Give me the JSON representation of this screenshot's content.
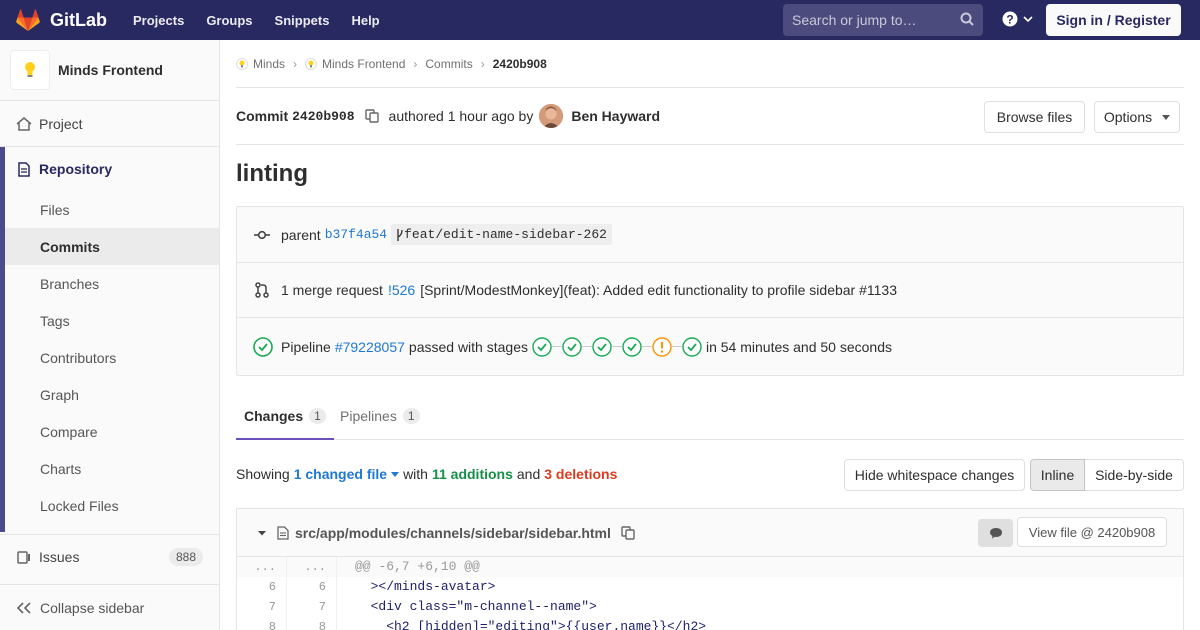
{
  "navbar": {
    "brand": "GitLab",
    "links": [
      "Projects",
      "Groups",
      "Snippets",
      "Help"
    ],
    "search_placeholder": "Search or jump to…",
    "signin_label": "Sign in / Register"
  },
  "sidebar": {
    "project_name": "Minds Frontend",
    "project_item": "Project",
    "repository": "Repository",
    "repo_items": [
      "Files",
      "Commits",
      "Branches",
      "Tags",
      "Contributors",
      "Graph",
      "Compare",
      "Charts",
      "Locked Files"
    ],
    "issues": "Issues",
    "issues_count": "888",
    "collapse": "Collapse sidebar"
  },
  "breadcrumb": [
    "Minds",
    "Minds Frontend",
    "Commits",
    "2420b908"
  ],
  "commit": {
    "label": "Commit",
    "sha": "2420b908",
    "authored": "authored 1 hour ago by",
    "author": "Ben Hayward",
    "browse_files": "Browse files",
    "options": "Options",
    "title": "linting"
  },
  "info": {
    "parent_label": "parent",
    "parent_sha": "b37f4a54",
    "branch": "feat/edit-name-sidebar-262",
    "mr_text": "1 merge request",
    "mr_link": "!526",
    "mr_title": "[Sprint/ModestMonkey](feat): Added edit functionality to profile sidebar #1133",
    "pipeline_label": "Pipeline",
    "pipeline_link": "#79228057",
    "pipeline_passed": "passed with stages",
    "pipeline_time": "in 54 minutes and 50 seconds",
    "stages": [
      "success",
      "success",
      "success",
      "success",
      "warning",
      "success"
    ],
    "colors": {
      "success": "#1aaa55",
      "warning": "#fc9403",
      "link": "#1f78d1"
    }
  },
  "tabs": [
    {
      "label": "Changes",
      "count": "1"
    },
    {
      "label": "Pipelines",
      "count": "1"
    }
  ],
  "diffbar": {
    "showing": "Showing",
    "changed_files": "1 changed file",
    "with": "with",
    "additions": "11 additions",
    "and": "and",
    "deletions": "3 deletions",
    "hide_ws": "Hide whitespace changes",
    "inline": "Inline",
    "side_by_side": "Side-by-side"
  },
  "file": {
    "path": "src/app/modules/channels/sidebar/sidebar.html",
    "view_file": "View file @ 2420b908",
    "lines": [
      {
        "old": "...",
        "new": "...",
        "code": "@@ -6,7 +6,10 @@",
        "hunk": true
      },
      {
        "old": "6",
        "new": "6",
        "code": "  ></minds-avatar>"
      },
      {
        "old": "7",
        "new": "7",
        "code": "  <div class=\"m-channel--name\">"
      },
      {
        "old": "8",
        "new": "8",
        "code": "    <h2 [hidden]=\"editing\">{{user.name}}</h2>"
      }
    ]
  }
}
